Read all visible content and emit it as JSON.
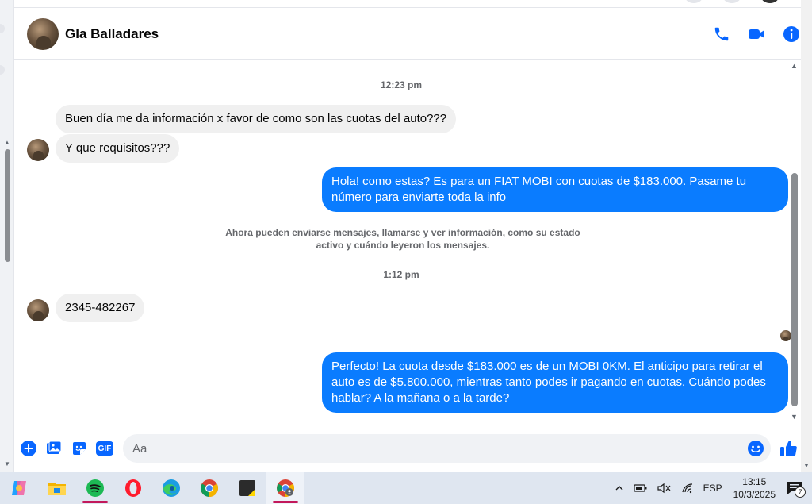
{
  "contact": {
    "name": "Gla Balladares"
  },
  "messages": {
    "time_1": "12:23 pm",
    "in_1": "Buen día me da información x favor de como son las cuotas del auto???",
    "in_2": "Y que requisitos???",
    "out_1": "Hola! como estas? Es para un FIAT MOBI con cuotas de $183.000. Pasame tu número para enviarte toda la info",
    "system_note": "Ahora pueden enviarse mensajes, llamarse y ver información, como su estado activo y cuándo leyeron los mensajes.",
    "time_2": "1:12 pm",
    "in_3": "2345-482267",
    "out_2": "Perfecto! La cuota desde $183.000 es de un MOBI 0KM. El anticipo para retirar el auto es de $5.800.000, mientras tanto podes ir pagando en cuotas. Cuándo podes hablar? A la mañana o a la tarde?"
  },
  "composer": {
    "placeholder": "Aa",
    "gif_label": "GIF"
  },
  "taskbar": {
    "language": "ESP",
    "time": "13:15",
    "date": "10/3/2025",
    "notification_count": "7"
  },
  "colors": {
    "accent": "#0a7cff",
    "incoming_bubble": "#f0f0f0",
    "icon_blue": "#0866ff"
  },
  "icons": [
    "phone-icon",
    "video-icon",
    "info-icon",
    "plus-icon",
    "photo-icon",
    "sticker-icon",
    "gif-icon",
    "emoji-icon",
    "thumbs-up-icon"
  ]
}
